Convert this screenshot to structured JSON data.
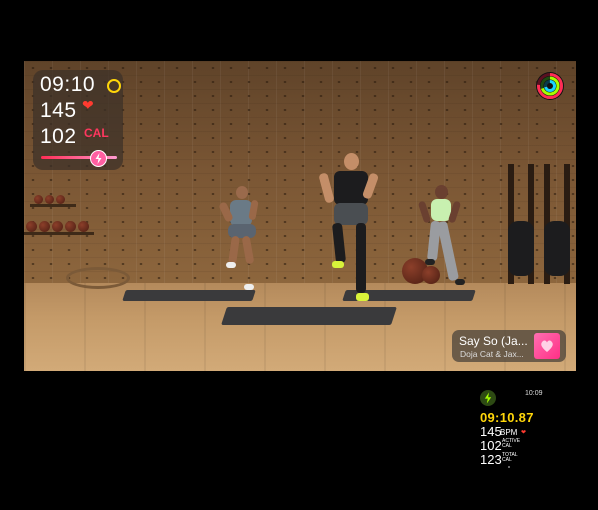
{
  "overlay": {
    "time": "09:10",
    "heart_rate": "145",
    "calories": "102",
    "calories_unit": "CAL"
  },
  "now_playing": {
    "title": "Say So (Ja...",
    "artist": "Doja Cat & Jax..."
  },
  "watch": {
    "clock": "10:09",
    "elapsed": "09:10.87",
    "bpm_value": "145",
    "bpm_unit": "BPM",
    "active_cal_value": "102",
    "active_cal_unit_1": "ACTIVE",
    "active_cal_unit_2": "CAL",
    "total_cal_value": "123",
    "total_cal_unit_1": "TOTAL",
    "total_cal_unit_2": "CAL"
  },
  "icons": {
    "time_ring": "ring-icon",
    "heart": "heart-icon",
    "burn_bar": "lightning-icon",
    "activity_rings": "activity-rings-icon",
    "album_art": "album-art-icon"
  },
  "colors": {
    "time_ring": "#ffd60a",
    "heart": "#ff3b30",
    "calories": "#ff375f",
    "elapsed": "#ffd60a"
  }
}
